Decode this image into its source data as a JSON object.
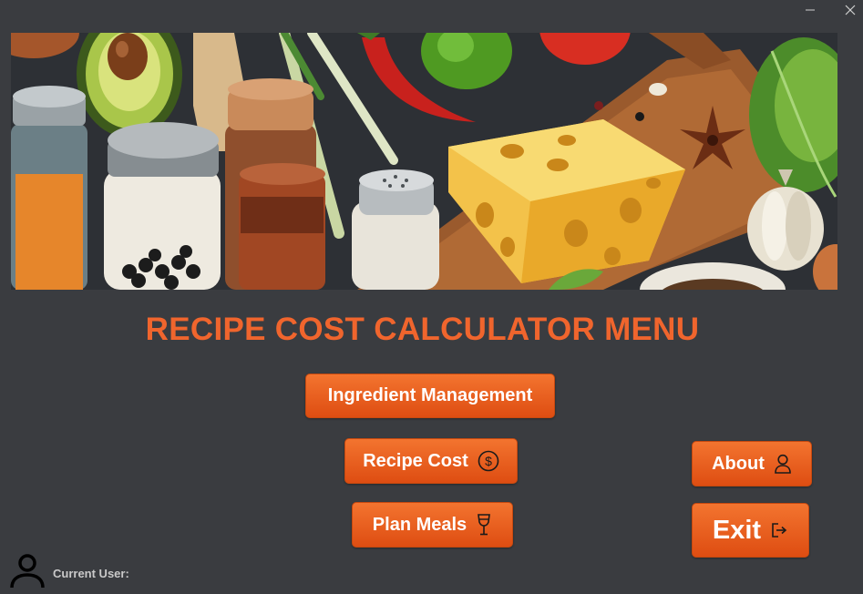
{
  "window": {
    "minimize_icon": "minimize-icon",
    "close_icon": "close-icon"
  },
  "banner": {
    "image": "kitchen-ingredients-illustration"
  },
  "title": "RECIPE COST CALCULATOR MENU",
  "buttons": {
    "ingredient_management": "Ingredient Management",
    "recipe_cost": "Recipe Cost",
    "plan_meals": "Plan Meals",
    "about": "About",
    "exit": "Exit"
  },
  "icons": {
    "recipe_cost": "dollar-circle-icon",
    "plan_meals": "wine-glass-icon",
    "about": "user-icon",
    "exit": "exit-icon",
    "current_user": "user-avatar-icon"
  },
  "footer": {
    "current_user_label": "Current User:"
  },
  "colors": {
    "background": "#3a3c40",
    "accent": "#f0652d",
    "button_top": "#f3742f",
    "button_bottom": "#de4d12"
  }
}
